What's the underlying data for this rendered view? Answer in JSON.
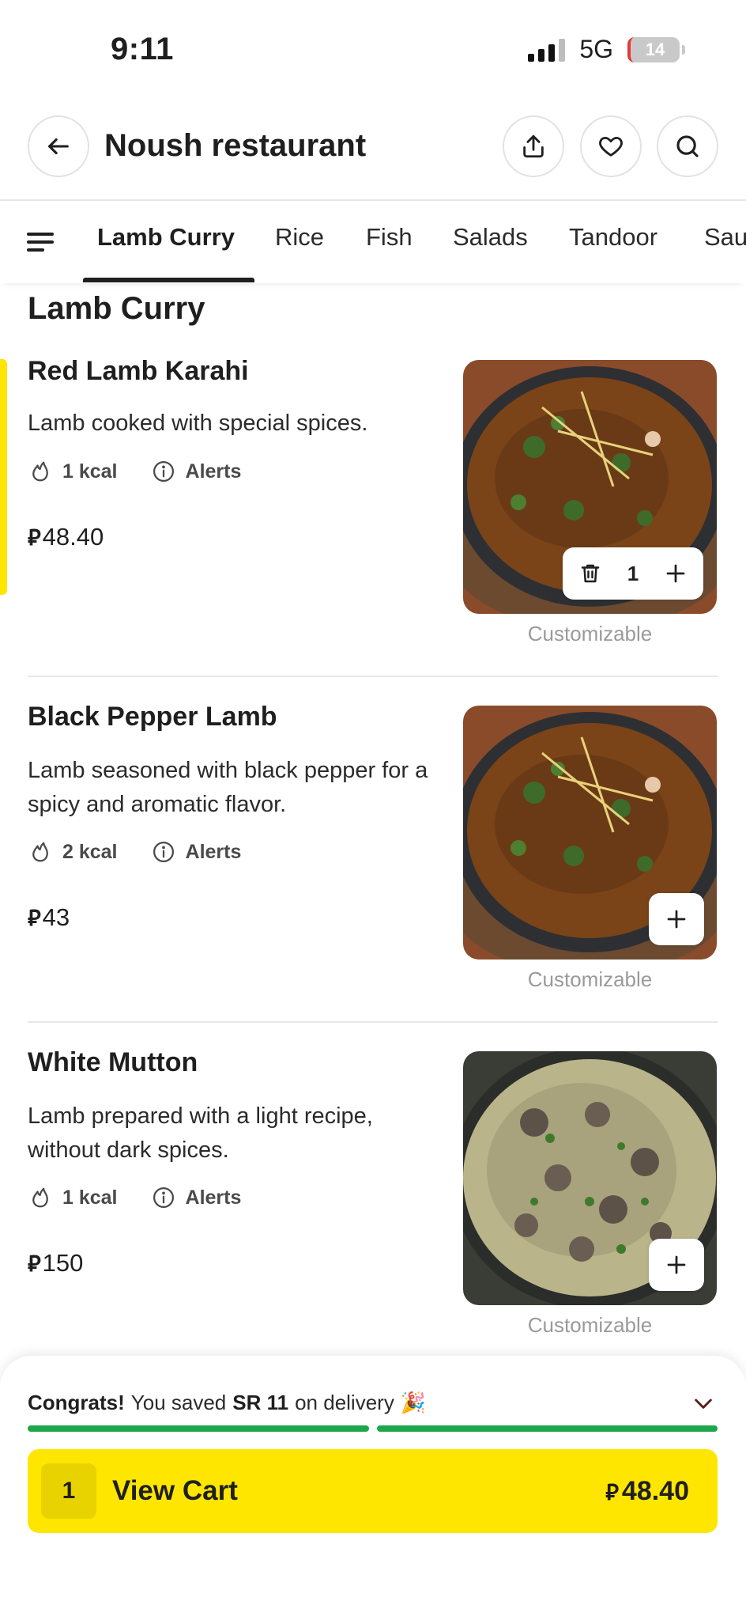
{
  "status_bar": {
    "time": "9:11",
    "network": "5G",
    "battery": "14"
  },
  "header": {
    "title": "Noush restaurant",
    "icons": [
      "arrow-left-icon",
      "share-icon",
      "heart-icon",
      "search-icon"
    ]
  },
  "tabs": [
    {
      "label": "Lamb Curry",
      "active": true
    },
    {
      "label": "Rice",
      "active": false
    },
    {
      "label": "Fish",
      "active": false
    },
    {
      "label": "Salads",
      "active": false
    },
    {
      "label": "Tandoor",
      "active": false
    },
    {
      "label": "Sau",
      "active": false
    }
  ],
  "section": {
    "title": "Lamb Curry"
  },
  "currency_symbol": "⃁",
  "items": [
    {
      "name": "Red Lamb Karahi",
      "description": "Lamb cooked with special spices.",
      "kcal": "1 kcal",
      "alerts": "Alerts",
      "price": "48.40",
      "note": "Customizable",
      "quantity": "1"
    },
    {
      "name": "Black Pepper Lamb",
      "description": "Lamb seasoned with black pepper for a spicy and aromatic flavor.",
      "kcal": "2 kcal",
      "alerts": "Alerts",
      "price": "43",
      "note": "Customizable"
    },
    {
      "name": "White Mutton",
      "description": "Lamb prepared with a light recipe, without dark spices.",
      "kcal": "1 kcal",
      "alerts": "Alerts",
      "price": "150",
      "note": "Customizable"
    }
  ],
  "savings": {
    "congrats": "Congrats!",
    "text_before": "You saved",
    "amount": "SR 11",
    "text_after": "on delivery",
    "emoji": "🎉"
  },
  "cart": {
    "count": "1",
    "label": "View Cart",
    "total": "48.40"
  },
  "colors": {
    "accent_yellow": "#ffe600",
    "progress_green": "#1ea64b",
    "text_primary": "#1f1f1f",
    "text_muted": "#9a9a9a"
  }
}
